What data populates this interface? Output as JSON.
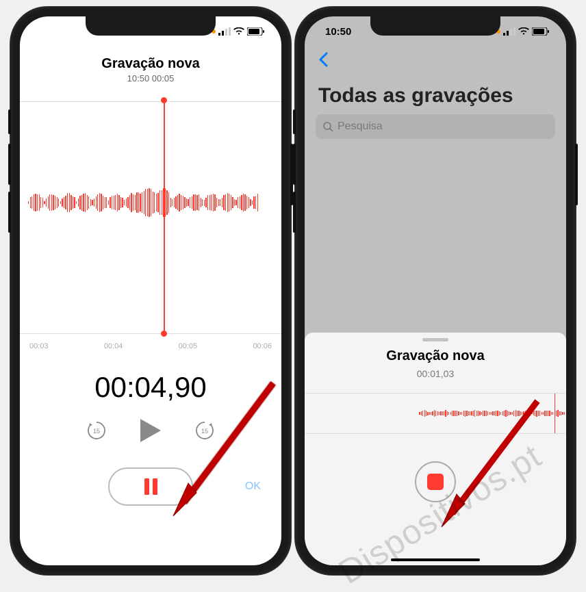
{
  "left": {
    "title": "Gravação nova",
    "subtitle": "10:50  00:05",
    "timeline": [
      "00:03",
      "00:04",
      "00:05",
      "00:06"
    ],
    "big_timer": "00:04,90",
    "ok_label": "OK"
  },
  "right": {
    "status_time": "10:50",
    "list_title": "Todas as gravações",
    "search_placeholder": "Pesquisa",
    "sheet_title": "Gravação nova",
    "sheet_time": "00:01,03"
  },
  "watermark": "Dispositivos.pt"
}
